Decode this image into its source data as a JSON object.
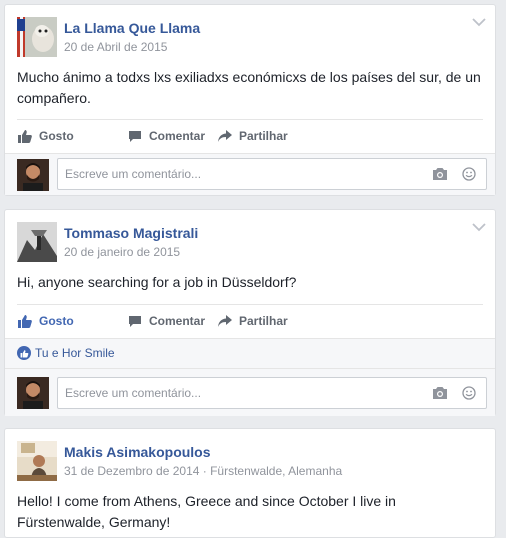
{
  "posts": [
    {
      "author": "La Llama Que Llama",
      "date": "20 de Abril de 2015",
      "text": "Mucho ánimo a todxs lxs exiliadxs económicxs de los países del sur, de un compañero.",
      "actions": {
        "like": "Gosto",
        "comment": "Comentar",
        "share": "Partilhar"
      },
      "liked": false,
      "comment_placeholder": "Escreve um comentário..."
    },
    {
      "author": "Tommaso Magistrali",
      "date": "20 de janeiro de 2015",
      "text": "Hi, anyone searching for a job in Düsseldorf?",
      "actions": {
        "like": "Gosto",
        "comment": "Comentar",
        "share": "Partilhar"
      },
      "liked": true,
      "likes_text": "Tu e Hor Smile",
      "comment_placeholder": "Escreve um comentário..."
    },
    {
      "author": "Makis Asimakopoulos",
      "date": "31 de Dezembro de 2014 · Fürstenwalde, Alemanha",
      "text": "Hello! I come from Athens, Greece and since October I live in Fürstenwalde, Germany!"
    }
  ],
  "colors": {
    "background": "#e9ebee",
    "author_link": "#365899",
    "liked_blue": "#4267b2",
    "meta_gray": "#90949c"
  },
  "icons": [
    "chevron-down-icon",
    "thumbs-up-icon",
    "comment-icon",
    "share-arrow-icon",
    "camera-icon",
    "smiley-icon"
  ]
}
